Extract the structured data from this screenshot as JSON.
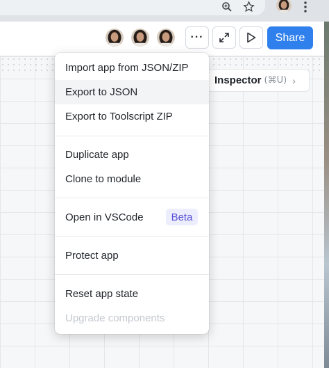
{
  "browser": {
    "icons": [
      "zoom-icon",
      "star-icon",
      "profile-avatar",
      "more-vert-icon"
    ]
  },
  "header": {
    "collaborators": [
      "avatar-user-1",
      "avatar-user-2",
      "avatar-user-3"
    ],
    "more_label": "···",
    "share_label": "Share"
  },
  "inspector": {
    "label": "Inspector",
    "shortcut": "(⌘U)",
    "chevron": "›"
  },
  "menu": {
    "groups": [
      [
        "Import app from JSON/ZIP",
        "Export to JSON",
        "Export to Toolscript ZIP"
      ],
      [
        "Duplicate app",
        "Clone to module"
      ],
      [
        "Open in VSCode"
      ],
      [
        "Protect app"
      ],
      [
        "Reset app state",
        "Upgrade components"
      ]
    ],
    "beta_badge": "Beta",
    "hovered_item": "Export to JSON",
    "disabled_item": "Upgrade components"
  },
  "colors": {
    "accent": "#2f80ed",
    "beta_bg": "#eceefe",
    "beta_text": "#5b50d6"
  }
}
